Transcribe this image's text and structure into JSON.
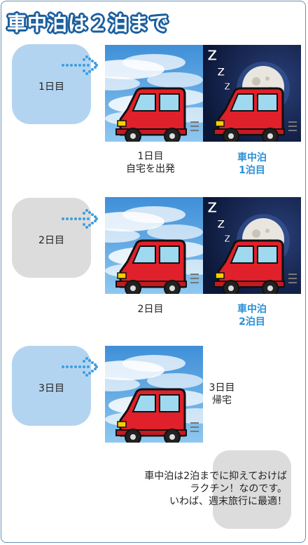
{
  "title": "車中泊は２泊まで",
  "days": [
    {
      "label": "1日目",
      "caption": [
        "1日目",
        "自宅を出発"
      ],
      "night_caption": [
        "車中泊",
        "1泊目"
      ]
    },
    {
      "label": "2日目",
      "caption": [
        "2日目"
      ],
      "night_caption": [
        "車中泊",
        "2泊目"
      ]
    },
    {
      "label": "3日目",
      "caption": [
        "3日目",
        "帰宅"
      ]
    }
  ],
  "message": [
    "車中泊は2泊までに抑えておけば",
    "ラクチン！なのです。",
    "いわば、週末旅行に最適！"
  ],
  "colors": {
    "accent_blue": "#2a8fd6",
    "title_outline": "#1a5e9e",
    "day_box_blue": "#b3d4f0",
    "day_box_gray": "#dcdcdc",
    "car_red": "#e0202a",
    "night_sky": "#0d1b3e"
  },
  "icons": [
    "dotted-arrow-icon",
    "car-icon",
    "moon-icon",
    "sleep-z-icon"
  ]
}
